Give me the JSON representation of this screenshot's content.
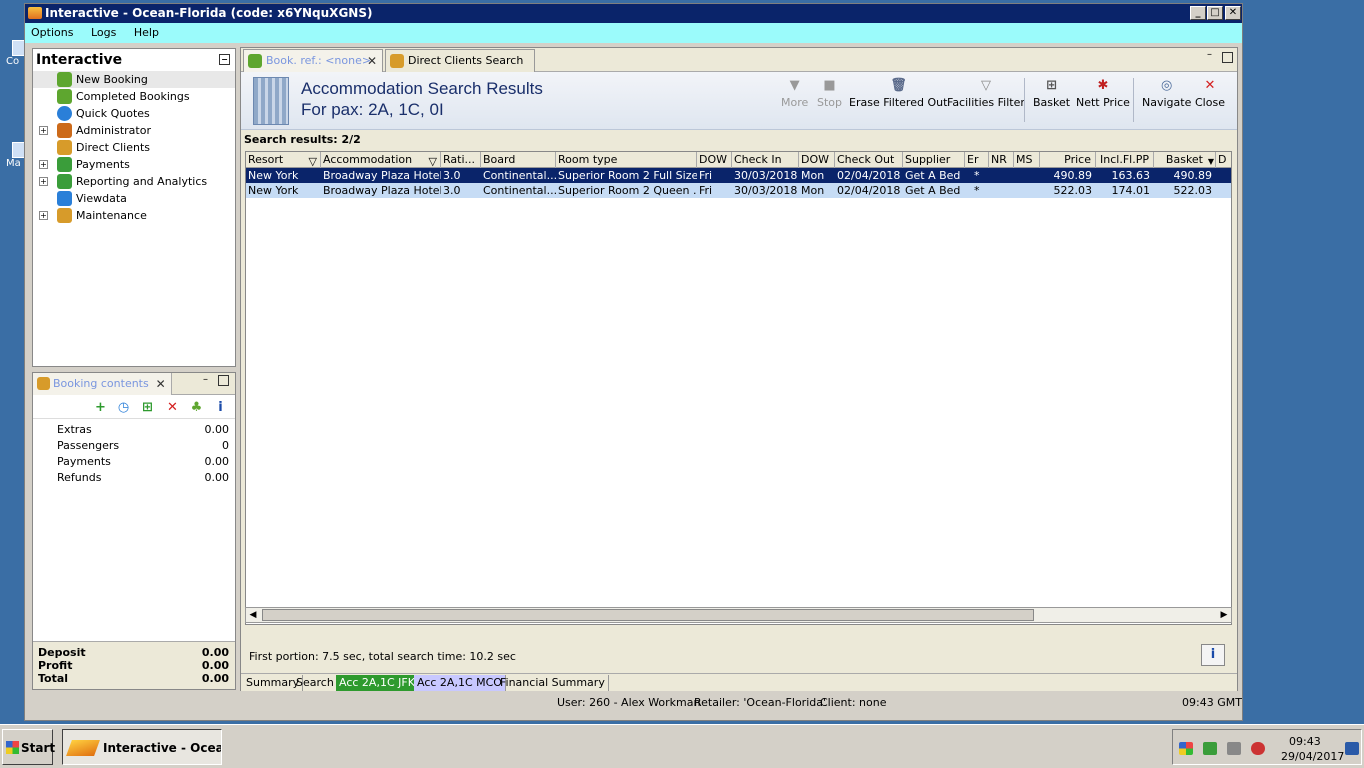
{
  "desktop": {
    "icon1_label": "Co",
    "icon2_label": "Ma"
  },
  "window": {
    "title": "Interactive - Ocean-Florida (code: x6YNquXGNS)"
  },
  "menu": [
    "Options",
    "Logs",
    "Help"
  ],
  "nav": {
    "title": "Interactive",
    "items": [
      {
        "label": "New Booking",
        "icon": "palm-icon",
        "color": "#5ea62f"
      },
      {
        "label": "Completed Bookings",
        "icon": "palm-icon",
        "color": "#5ea62f"
      },
      {
        "label": "Quick Quotes",
        "icon": "clock-icon",
        "color": "#2a7fd8"
      },
      {
        "label": "Administrator",
        "icon": "person-icon",
        "color": "#cc6a1a"
      },
      {
        "label": "Direct Clients",
        "icon": "client-icon",
        "color": "#d79b2a"
      },
      {
        "label": "Payments",
        "icon": "payments-icon",
        "color": "#3a9d3a"
      },
      {
        "label": "Reporting and Analytics",
        "icon": "report-icon",
        "color": "#3a9d3a"
      },
      {
        "label": "Viewdata",
        "icon": "viewdata-icon",
        "color": "#2a7fd8"
      },
      {
        "label": "Maintenance",
        "icon": "maintenance-icon",
        "color": "#d79b2a"
      }
    ]
  },
  "booking": {
    "tab_label": "Booking contents",
    "rows": [
      {
        "label": "Extras",
        "value": "0.00"
      },
      {
        "label": "Passengers",
        "value": "0"
      },
      {
        "label": "Payments",
        "value": "0.00"
      },
      {
        "label": "Refunds",
        "value": "0.00"
      }
    ],
    "totals": [
      {
        "label": "Deposit",
        "value": "0.00"
      },
      {
        "label": "Profit",
        "value": "0.00"
      },
      {
        "label": "Total",
        "value": "0.00"
      }
    ]
  },
  "tabs": [
    {
      "label": "Book. ref.: <none>"
    },
    {
      "label": "Direct Clients Search"
    }
  ],
  "header": {
    "title": "Accommodation Search Results",
    "subtitle": "For pax: 2A, 1C, 0I"
  },
  "toolbar": {
    "more": "More",
    "stop": "Stop",
    "erase": "Erase Filtered Out",
    "facilities": "Facilities Filter",
    "basket": "Basket",
    "nett": "Nett Price",
    "navigate": "Navigate",
    "close": "Close"
  },
  "search_results_label": "Search results: 2/2",
  "grid": {
    "columns": [
      "Resort",
      "Accommodation",
      "Rati...",
      "Board",
      "Room type",
      "DOW",
      "Check In",
      "DOW",
      "Check Out",
      "Supplier",
      "Er",
      "NR",
      "MS",
      "Price",
      "Incl.Fl.PP",
      "Basket",
      "D"
    ],
    "rows": [
      [
        "New York",
        "Broadway Plaza Hotel",
        "3.0",
        "Continental...",
        "Superior Room 2 Full Size ...",
        "Fri",
        "30/03/2018",
        "Mon",
        "02/04/2018",
        "Get A Bed",
        "*",
        "",
        "",
        "490.89",
        "163.63",
        "490.89",
        ""
      ],
      [
        "New York",
        "Broadway Plaza Hotel",
        "3.0",
        "Continental...",
        "Superior Room  2 Queen ...",
        "Fri",
        "30/03/2018",
        "Mon",
        "02/04/2018",
        "Get A Bed",
        "*",
        "",
        "",
        "522.03",
        "174.01",
        "522.03",
        ""
      ]
    ]
  },
  "timing": "First portion: 7.5 sec, total search time: 10.2 sec",
  "bottom_tabs": [
    "Summary",
    "Search",
    "Acc 2A,1C JFK",
    "Acc 2A,1C MCO",
    "Financial Summary"
  ],
  "status": {
    "user": "User: 260 - Alex Workman",
    "retailer": "Retailer: 'Ocean-Florida'",
    "client": "Client: none",
    "time": "09:43 GMT"
  },
  "taskbar": {
    "start": "Start",
    "app": "Interactive - Ocea...",
    "clock_time": "09:43",
    "clock_date": "29/04/2017"
  },
  "colors": {
    "title_bar": "#0a246a",
    "menu_bar": "#9bfbfb",
    "tab_jfk": "#2e9a2e",
    "tab_mco": "#c8c8ff",
    "selected_row": "#0a246a",
    "alt_row": "#c6dcf5"
  }
}
